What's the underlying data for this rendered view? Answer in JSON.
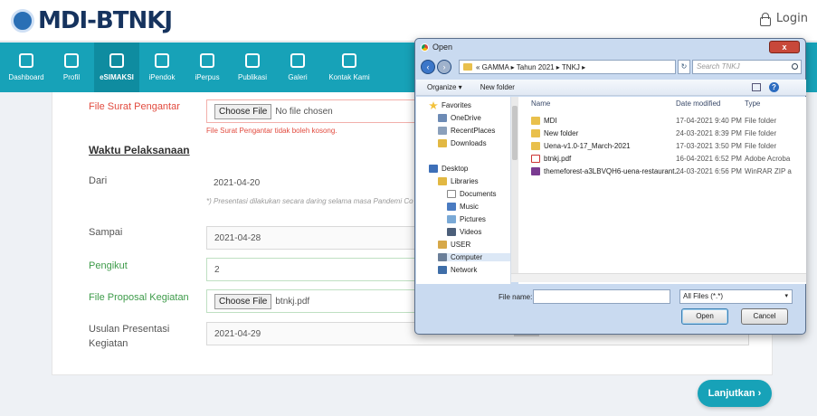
{
  "header": {
    "logo": "MDI-BTNKJ",
    "login_label": "Login"
  },
  "nav": {
    "items": [
      {
        "label": "Dashboard"
      },
      {
        "label": "Profil"
      },
      {
        "label": "eSIMAKSI"
      },
      {
        "label": "iPendok"
      },
      {
        "label": "iPerpus"
      },
      {
        "label": "Publikasi"
      },
      {
        "label": "Galeri"
      },
      {
        "label": "Kontak Kami"
      }
    ]
  },
  "form": {
    "surat_label": "File Surat Pengantar",
    "choose_file": "Choose File",
    "surat_value": "No file chosen",
    "surat_error": "File Surat Pengantar tidak boleh kosong.",
    "section_title": "Waktu Pelaksanaan",
    "dari_label": "Dari",
    "dari_value": "2021-04-20",
    "dari_help": "*) Presentasi dilakukan secara daring selama masa Pandemi Co",
    "sampai_label": "Sampai",
    "sampai_value": "2021-04-28",
    "pengikut_label": "Pengikut",
    "pengikut_value": "2",
    "proposal_label": "File Proposal Kegiatan",
    "proposal_value": "btnkj.pdf",
    "usulan_label_1": "Usulan Presentasi",
    "usulan_label_2": "Kegiatan",
    "usulan_value": "2021-04-29",
    "next_button": "Lanjutkan ›"
  },
  "dialog": {
    "title": "Open",
    "close": "x",
    "breadcrumb": "« GAMMA ▸ Tahun 2021 ▸ TNKJ ▸",
    "search_placeholder": "Search TNKJ",
    "organize": "Organize ▾",
    "new_folder": "New folder",
    "tree": [
      {
        "label": "Favorites"
      },
      {
        "label": "OneDrive"
      },
      {
        "label": "RecentPlaces"
      },
      {
        "label": "Downloads"
      },
      {
        "label": "Desktop"
      },
      {
        "label": "Libraries"
      },
      {
        "label": "Documents"
      },
      {
        "label": "Music"
      },
      {
        "label": "Pictures"
      },
      {
        "label": "Videos"
      },
      {
        "label": "USER"
      },
      {
        "label": "Computer"
      },
      {
        "label": "Network"
      }
    ],
    "columns": {
      "name": "Name",
      "date": "Date modified",
      "type": "Type"
    },
    "files": [
      {
        "name": "MDI",
        "date": "17-04-2021 9:40 PM",
        "type": "File folder"
      },
      {
        "name": "New folder",
        "date": "24-03-2021 8:39 PM",
        "type": "File folder"
      },
      {
        "name": "Uena-v1.0-17_March-2021",
        "date": "17-03-2021 3:50 PM",
        "type": "File folder"
      },
      {
        "name": "btnkj.pdf",
        "date": "16-04-2021 6:52 PM",
        "type": "Adobe Acroba"
      },
      {
        "name": "themeforest-a3LBVQH6-uena-restaurant...",
        "date": "24-03-2021 6:56 PM",
        "type": "WinRAR ZIP a"
      }
    ],
    "file_name_label": "File name:",
    "file_name_value": "",
    "filter": "All Files (*.*)",
    "open": "Open",
    "cancel": "Cancel"
  }
}
